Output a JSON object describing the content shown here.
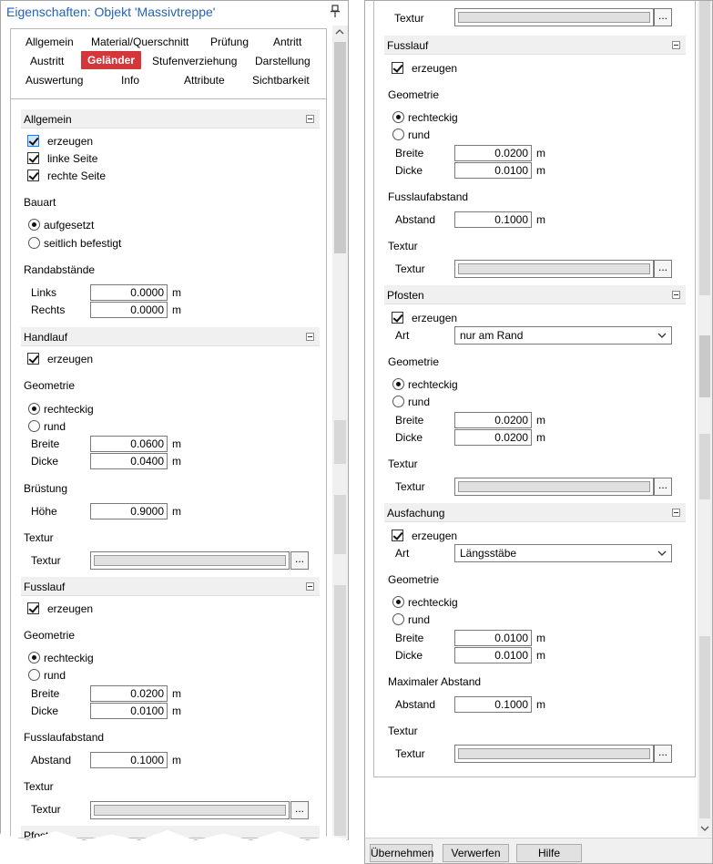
{
  "left": {
    "title": "Eigenschaften: Objekt 'Massivtreppe'",
    "tabs": [
      {
        "label": "Allgemein",
        "active": false
      },
      {
        "label": "Material/Querschnitt",
        "active": false
      },
      {
        "label": "Prüfung",
        "active": false
      },
      {
        "label": "Antritt",
        "active": false
      },
      {
        "label": "Austritt",
        "active": false
      },
      {
        "label": "Geländer",
        "active": true
      },
      {
        "label": "Stufenverziehung",
        "active": false
      },
      {
        "label": "Darstellung",
        "active": false
      },
      {
        "label": "Auswertung",
        "active": false
      },
      {
        "label": "Info",
        "active": false
      },
      {
        "label": "Attribute",
        "active": false
      },
      {
        "label": "Sichtbarkeit",
        "active": false
      }
    ],
    "allgemein": {
      "title": "Allgemein",
      "erzeugen": "erzeugen",
      "linke_seite": "linke Seite",
      "rechte_seite": "rechte Seite",
      "bauart_label": "Bauart",
      "bauart_opt1": "aufgesetzt",
      "bauart_opt2": "seitlich befestigt",
      "rand_label": "Randabstände",
      "links_label": "Links",
      "links_value": "0.0000",
      "rechts_label": "Rechts",
      "rechts_value": "0.0000",
      "unit": "m"
    },
    "handlauf": {
      "title": "Handlauf",
      "erzeugen": "erzeugen",
      "geometrie": "Geometrie",
      "opt_rechteckig": "rechteckig",
      "opt_rund": "rund",
      "breite_label": "Breite",
      "breite_value": "0.0600",
      "dicke_label": "Dicke",
      "dicke_value": "0.0400",
      "bruestung": "Brüstung",
      "hoehe_label": "Höhe",
      "hoehe_value": "0.9000",
      "textur_group": "Textur",
      "textur_label": "Textur",
      "browse": "...",
      "unit": "m"
    },
    "fusslauf": {
      "title": "Fusslauf",
      "erzeugen": "erzeugen",
      "geometrie": "Geometrie",
      "opt_rechteckig": "rechteckig",
      "opt_rund": "rund",
      "breite_label": "Breite",
      "breite_value": "0.0200",
      "dicke_label": "Dicke",
      "dicke_value": "0.0100",
      "abstand_group": "Fusslaufabstand",
      "abstand_label": "Abstand",
      "abstand_value": "0.1000",
      "textur_group": "Textur",
      "textur_label": "Textur",
      "browse": "...",
      "unit": "m"
    },
    "pfosten_title": "Pfosten"
  },
  "right": {
    "top_textur_label": "Textur",
    "fusslauf": {
      "title": "Fusslauf",
      "erzeugen": "erzeugen",
      "geometrie": "Geometrie",
      "opt_rechteckig": "rechteckig",
      "opt_rund": "rund",
      "breite_label": "Breite",
      "breite_value": "0.0200",
      "dicke_label": "Dicke",
      "dicke_value": "0.0100",
      "abstand_group": "Fusslaufabstand",
      "abstand_label": "Abstand",
      "abstand_value": "0.1000",
      "textur_group": "Textur",
      "textur_label": "Textur",
      "browse": "...",
      "unit": "m"
    },
    "pfosten": {
      "title": "Pfosten",
      "erzeugen": "erzeugen",
      "art_label": "Art",
      "art_value": "nur am Rand",
      "geometrie": "Geometrie",
      "opt_rechteckig": "rechteckig",
      "opt_rund": "rund",
      "breite_label": "Breite",
      "breite_value": "0.0200",
      "dicke_label": "Dicke",
      "dicke_value": "0.0200",
      "textur_group": "Textur",
      "textur_label": "Textur",
      "browse": "...",
      "unit": "m"
    },
    "ausfachung": {
      "title": "Ausfachung",
      "erzeugen": "erzeugen",
      "art_label": "Art",
      "art_value": "Längsstäbe",
      "geometrie": "Geometrie",
      "opt_rechteckig": "rechteckig",
      "opt_rund": "rund",
      "breite_label": "Breite",
      "breite_value": "0.0100",
      "dicke_label": "Dicke",
      "dicke_value": "0.0100",
      "abstand_group": "Maximaler Abstand",
      "abstand_label": "Abstand",
      "abstand_value": "0.1000",
      "textur_group": "Textur",
      "textur_label": "Textur",
      "browse": "...",
      "unit": "m"
    },
    "buttons": {
      "apply": "Übernehmen",
      "discard": "Verwerfen",
      "help": "Hilfe"
    }
  },
  "icons": {
    "pin": "pin-icon",
    "collapse": "collapse-icon",
    "check": "checkmark-icon",
    "chevron": "chevron-down-icon",
    "scroll_up": "arrow-up-icon",
    "scroll_down": "arrow-down-icon"
  },
  "colors": {
    "title_blue": "#2462b8",
    "active_tab_red": "#d4373b",
    "section_header_bg": "#f0f0f0"
  }
}
